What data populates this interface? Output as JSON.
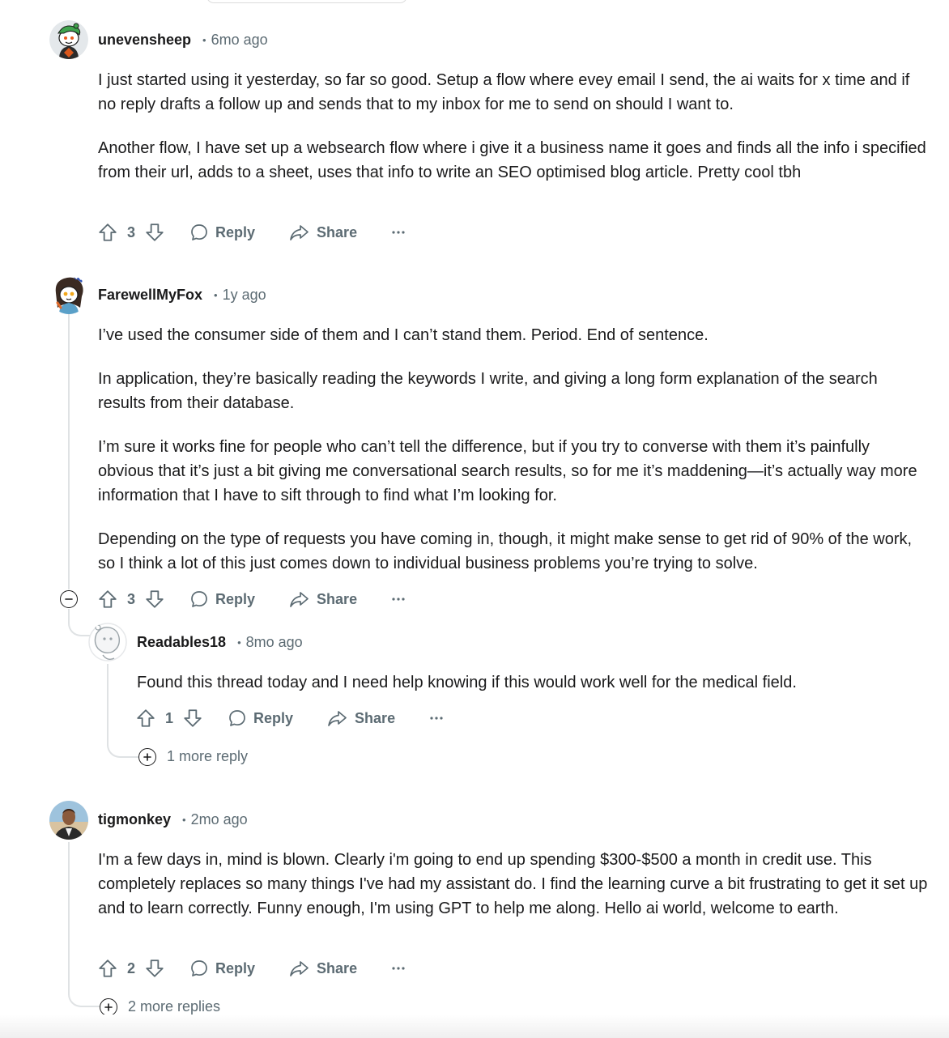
{
  "comments": [
    {
      "username": "unevensheep",
      "time": "6mo ago",
      "paragraphs": [
        "I just started using it yesterday, so far so good. Setup a flow where evey email I send, the ai waits for x time and if no reply drafts a follow up and sends that to my inbox for me to send on should I want to.",
        "Another flow, I have set up a websearch flow where i give it a business name it goes and finds all the info i specified from their url, adds to a sheet, uses that info to write an SEO optimised blog article. Pretty cool tbh"
      ],
      "score": "3",
      "reply_label": "Reply",
      "share_label": "Share"
    },
    {
      "username": "FarewellMyFox",
      "time": "1y ago",
      "paragraphs": [
        "I’ve used the consumer side of them and I can’t stand them. Period. End of sentence.",
        "In application, they’re basically reading the keywords I write, and giving a long form explanation of the search results from their database.",
        "I’m sure it works fine for people who can’t tell the difference, but if you try to converse with them it’s painfully obvious that it’s just a bit giving me conversational search results, so for me it’s maddening—it’s actually way more information that I have to sift through to find what I’m looking for.",
        "Depending on the type of requests you have coming in, though, it might make sense to get rid of 90% of the work, so I think a lot of this just comes down to individual business problems you’re trying to solve."
      ],
      "score": "3",
      "reply_label": "Reply",
      "share_label": "Share"
    },
    {
      "username": "Readables18",
      "time": "8mo ago",
      "paragraphs": [
        "Found this thread today and I need help knowing if this would work well for the medical field."
      ],
      "score": "1",
      "reply_label": "Reply",
      "share_label": "Share",
      "more_replies": "1 more reply"
    },
    {
      "username": "tigmonkey",
      "time": "2mo ago",
      "paragraphs": [
        "I'm a few days in, mind is blown. Clearly i'm going to end up spending $300-$500 a month in credit use. This completely replaces so many things I've had my assistant do. I find the learning curve a bit frustrating to get it set up and to learn correctly. Funny enough, I'm using GPT to help me along. Hello ai world, welcome to earth."
      ],
      "score": "2",
      "reply_label": "Reply",
      "share_label": "Share",
      "more_replies": "2 more replies"
    }
  ],
  "separator": "•",
  "icons": {
    "upvote": "arrow-up-outline-icon",
    "downvote": "arrow-down-outline-icon",
    "reply": "speech-bubble-icon",
    "share": "share-arrow-icon",
    "more": "ellipsis-icon",
    "collapse": "minus-circle-icon",
    "expand": "plus-circle-icon"
  },
  "colors": {
    "text": "#1a1a1b",
    "meta": "#5c6b73",
    "thread_line": "#dfe2e4"
  }
}
